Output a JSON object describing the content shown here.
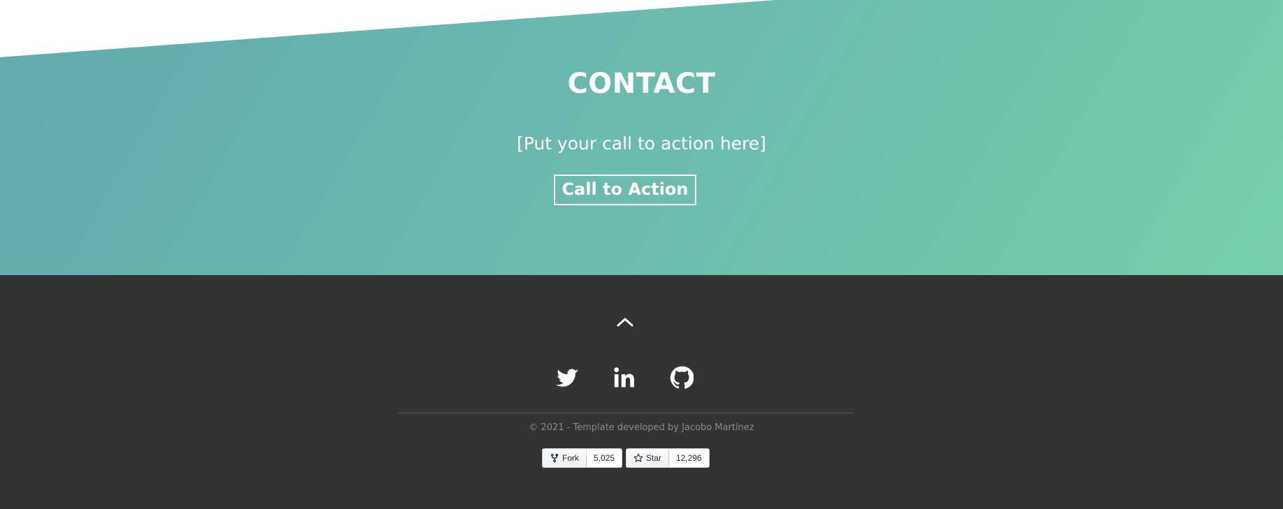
{
  "contact": {
    "title": "CONTACT",
    "subtitle": "[Put your call to action here]",
    "cta_label": "Call to Action"
  },
  "footer": {
    "back_to_top_icon": "chevron-up-icon",
    "social_links": [
      {
        "icon": "twitter-icon"
      },
      {
        "icon": "linkedin-icon"
      },
      {
        "icon": "github-icon"
      }
    ],
    "copyright": "© 2021 - Template developed by Jacobo Martínez",
    "github_buttons": {
      "fork": {
        "label": "Fork",
        "count": "5,025",
        "icon": "fork-icon"
      },
      "star": {
        "label": "Star",
        "count": "12,296",
        "icon": "star-icon"
      }
    }
  },
  "colors": {
    "gradient_start": "#62aaae",
    "gradient_end": "#76cfaa",
    "footer_bg": "#333333",
    "text_light": "#ffffff",
    "copyright_text": "#8a8a8a"
  }
}
